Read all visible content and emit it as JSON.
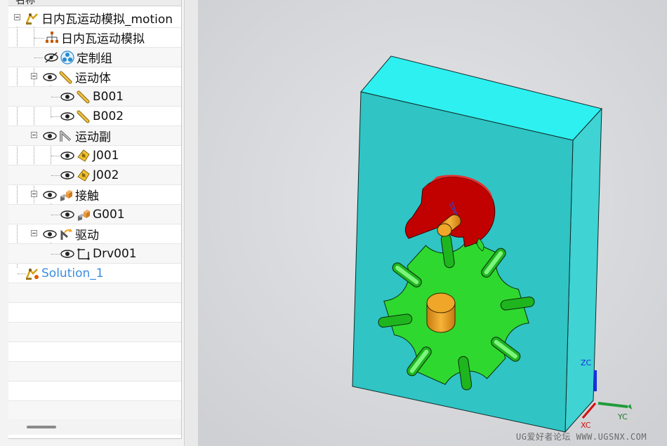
{
  "navigator": {
    "column_header": "名称",
    "rows": [
      {
        "label": "日内瓦运动模拟_motion",
        "icon": "motion-sim-icon"
      },
      {
        "label": "日内瓦运动模拟",
        "icon": "assembly-tree-icon"
      },
      {
        "label": "定制组",
        "icon": "custom-group-icon"
      },
      {
        "label": "运动体",
        "icon": "link-body-icon"
      },
      {
        "label": "B001",
        "icon": "link-body-icon"
      },
      {
        "label": "B002",
        "icon": "link-body-icon"
      },
      {
        "label": "运动副",
        "icon": "joint-icon"
      },
      {
        "label": "J001",
        "icon": "revolute-joint-icon"
      },
      {
        "label": "J002",
        "icon": "revolute-joint-icon"
      },
      {
        "label": "接触",
        "icon": "contact-icon"
      },
      {
        "label": "G001",
        "icon": "contact-icon"
      },
      {
        "label": "驱动",
        "icon": "driver-icon"
      },
      {
        "label": "Drv001",
        "icon": "driver-element-icon"
      },
      {
        "label": "Solution_1",
        "icon": "solution-icon"
      }
    ]
  },
  "viewport": {
    "axes": {
      "z": "ZC",
      "y": "YC",
      "x": "XC"
    },
    "colors": {
      "background": "#d8d9dc",
      "block_front": "#2fc7c7",
      "block_top": "#26ebeb",
      "block_side": "#3bd2d2",
      "geneva_wheel": "#2ee02e",
      "crank": "#c40000",
      "pin": "#f5a623",
      "axis_z": "#1a2fe0",
      "axis_y": "#1f9c3a",
      "axis_x": "#d01010"
    }
  },
  "watermark": "UG爱好者论坛 WWW.UGSNX.COM"
}
